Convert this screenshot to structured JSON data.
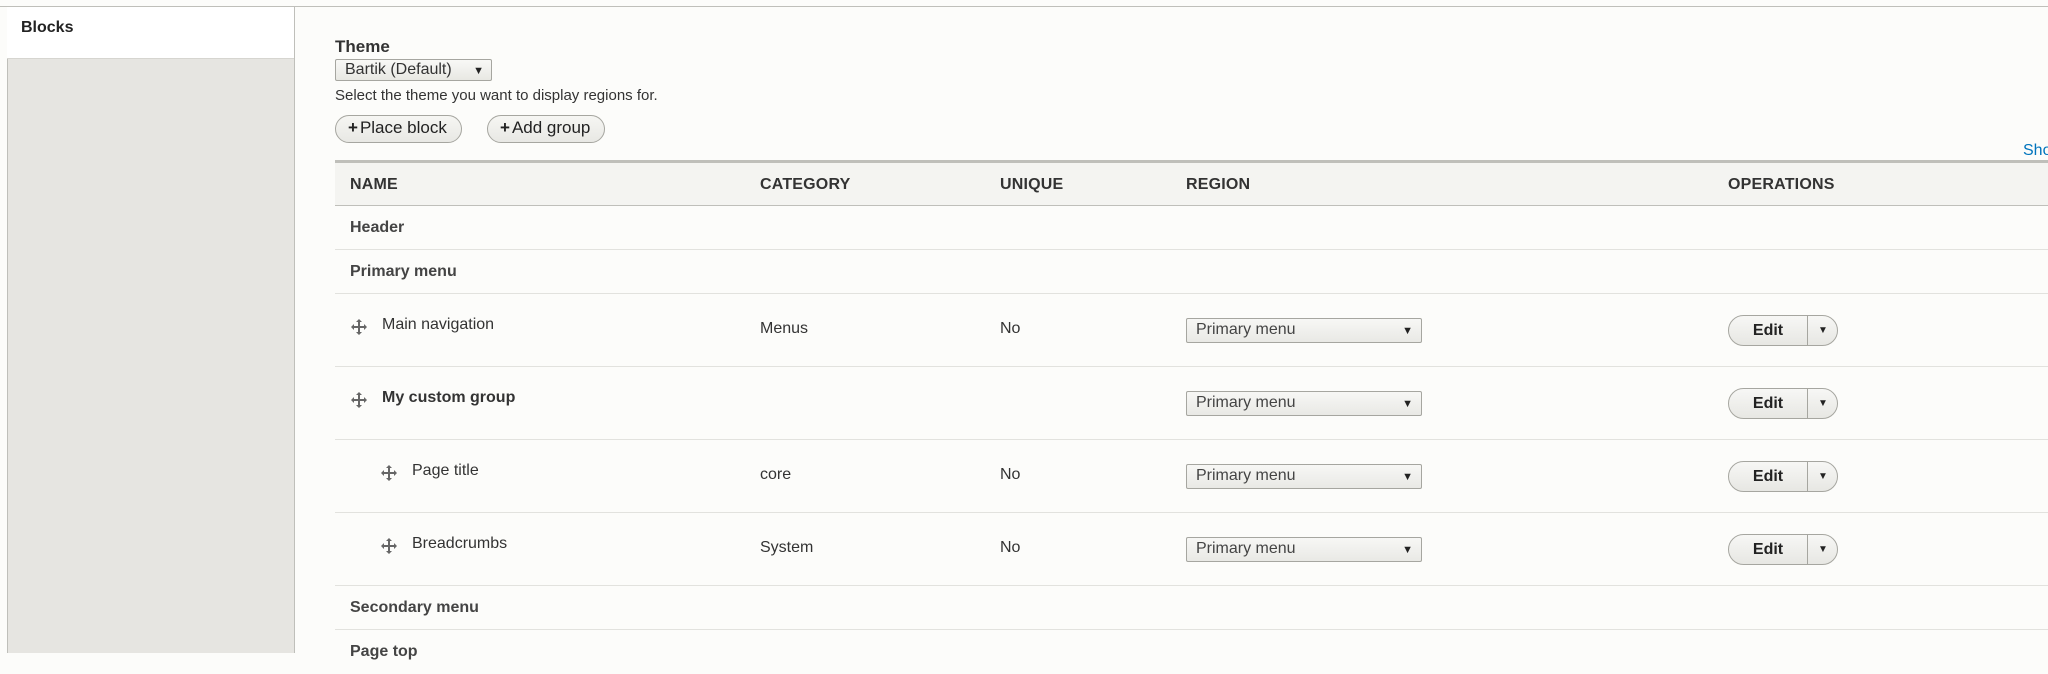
{
  "sidebar": {
    "tab_label": "Blocks"
  },
  "theme": {
    "label": "Theme",
    "selected": "Bartik (Default)",
    "description": "Select the theme you want to display regions for."
  },
  "actions": {
    "place_block": "Place block",
    "add_group": "Add group"
  },
  "show_link": "Sho",
  "table": {
    "headers": {
      "name": "NAME",
      "category": "CATEGORY",
      "unique": "UNIQUE",
      "region": "REGION",
      "operations": "OPERATIONS"
    },
    "regions": [
      "Header",
      "Primary menu",
      "Secondary menu",
      "Page top"
    ],
    "rows": [
      {
        "name": "Main navigation",
        "category": "Menus",
        "unique": "No",
        "region": "Primary menu",
        "op": "Edit"
      },
      {
        "name": "My custom group",
        "category": "",
        "unique": "",
        "region": "Primary menu",
        "op": "Edit"
      },
      {
        "name": "Page title",
        "category": "core",
        "unique": "No",
        "region": "Primary menu",
        "op": "Edit"
      },
      {
        "name": "Breadcrumbs",
        "category": "System",
        "unique": "No",
        "region": "Primary menu",
        "op": "Edit"
      }
    ]
  },
  "colors": {
    "link": "#0074bd",
    "sidebar_bg": "#e6e5e1",
    "page_bg": "#fcfcfa"
  }
}
